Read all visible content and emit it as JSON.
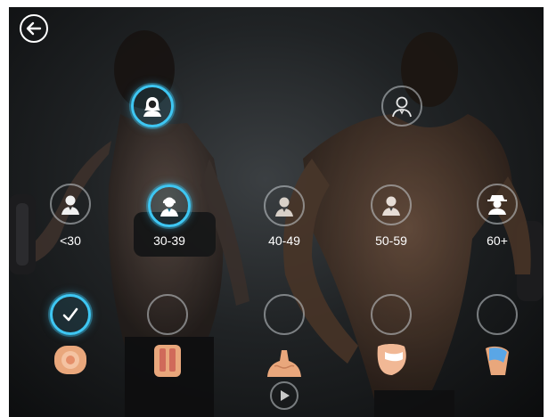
{
  "nav": {
    "back_icon": "back-arrow-icon"
  },
  "gender": {
    "female": {
      "icon": "female-user-icon",
      "selected": true
    },
    "male": {
      "icon": "male-user-icon",
      "selected": false
    }
  },
  "age_groups": [
    {
      "label": "<30",
      "icon": "man-user-icon",
      "selected": false
    },
    {
      "label": "30-39",
      "icon": "woman-user-icon",
      "selected": true
    },
    {
      "label": "40-49",
      "icon": "man-user-icon",
      "selected": false
    },
    {
      "label": "50-59",
      "icon": "man-user-icon",
      "selected": false
    },
    {
      "label": "60+",
      "icon": "man-hat-user-icon",
      "selected": false
    }
  ],
  "body_parts": [
    {
      "name": "abdomen",
      "icon": "abdomen-icon",
      "selected": true
    },
    {
      "name": "back",
      "icon": "lower-back-icon",
      "selected": false
    },
    {
      "name": "shoulders",
      "icon": "shoulders-icon",
      "selected": false
    },
    {
      "name": "buttocks",
      "icon": "buttocks-icon",
      "selected": false
    },
    {
      "name": "thigh",
      "icon": "thigh-icon",
      "selected": false
    }
  ],
  "play": {
    "icon": "play-icon"
  },
  "colors": {
    "accent": "#3ec6f2",
    "skin": "#e9a77c",
    "text": "#ffffff"
  }
}
